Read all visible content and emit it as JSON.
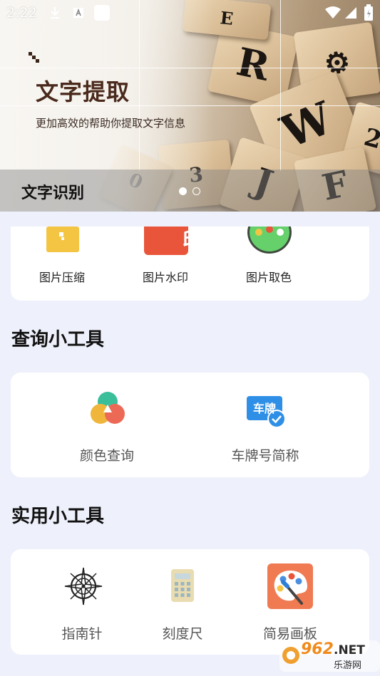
{
  "status_bar": {
    "time": "2:22",
    "icons": [
      "download-icon",
      "a-box-icon",
      "square-icon",
      "wifi-icon",
      "cell-signal-icon",
      "battery-icon"
    ]
  },
  "banner": {
    "title": "文字提取",
    "subtitle": "更加高效的帮助你提取文字信息",
    "caption": "文字识别",
    "tile_letters": [
      "R",
      "W",
      "3",
      "2",
      "J",
      "F",
      "E",
      "0"
    ],
    "page_indicator": {
      "count": 2,
      "active_index": 0
    }
  },
  "image_tools": {
    "items": [
      {
        "label": "图片压缩",
        "icon": "archive-box-icon",
        "color": "#f4c443"
      },
      {
        "label": "图片水印",
        "icon": "stamp-icon",
        "icon_text": "印",
        "color": "#e8553a"
      },
      {
        "label": "图片取色",
        "icon": "palette-icon",
        "color": "#66d16b"
      }
    ]
  },
  "query_tools": {
    "title": "查询小工具",
    "items": [
      {
        "label": "颜色查询",
        "icon": "color-circles-icon"
      },
      {
        "label": "车牌号简称",
        "icon": "license-plate-icon",
        "icon_text": "车牌",
        "color": "#2f8fe6"
      }
    ]
  },
  "utility_tools": {
    "title": "实用小工具",
    "items": [
      {
        "label": "指南针",
        "icon": "compass-icon"
      },
      {
        "label": "刻度尺",
        "icon": "ruler-calculator-icon"
      },
      {
        "label": "简易画板",
        "icon": "paint-palette-icon",
        "color": "#f07a52"
      }
    ]
  },
  "watermark": {
    "number": "962",
    "suffix": ".NET",
    "caption": "乐游网"
  },
  "colors": {
    "background": "#eef1fb",
    "card": "#ffffff",
    "accent_blue": "#2f8fe6"
  }
}
